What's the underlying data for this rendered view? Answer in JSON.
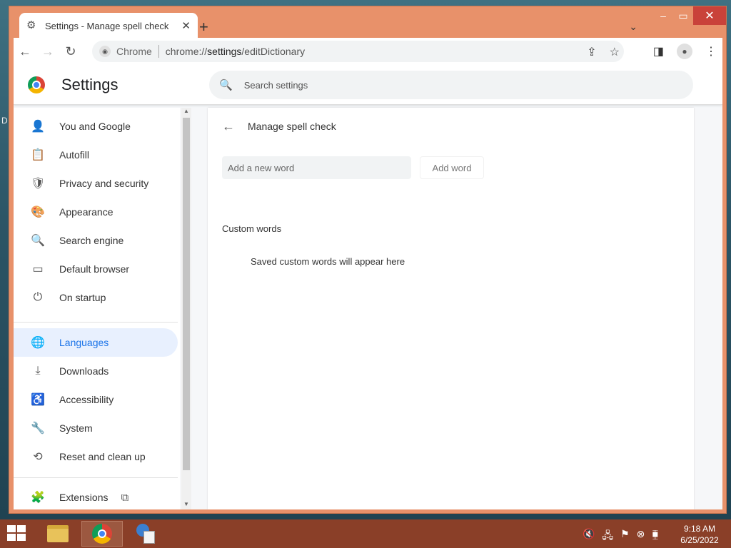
{
  "desktop": {
    "edge_glyph": "D"
  },
  "window": {
    "tab": {
      "title": "Settings - Manage spell check",
      "favicon": "gear-icon",
      "close": "✕"
    },
    "new_tab": "+",
    "tab_search_chevron": "⌄",
    "controls": {
      "minimize": "–",
      "maximize": "▭",
      "close": "✕"
    }
  },
  "toolbar": {
    "back": "←",
    "forward": "→",
    "reload": "↻",
    "site_label": "Chrome",
    "url_scheme": "chrome://",
    "url_host": "settings",
    "url_path": "/editDictionary",
    "share": "⇪",
    "bookmark": "☆",
    "side_panel": "◨",
    "menu": "⋮"
  },
  "settings": {
    "title": "Settings",
    "search": {
      "placeholder": "Search settings",
      "icon": "search-icon"
    },
    "nav": [
      {
        "label": "You and Google",
        "icon": "person-icon",
        "glyph": "👤"
      },
      {
        "label": "Autofill",
        "icon": "clipboard-icon",
        "glyph": "📋"
      },
      {
        "label": "Privacy and security",
        "icon": "shield-icon",
        "glyph": "🛡"
      },
      {
        "label": "Appearance",
        "icon": "palette-icon",
        "glyph": "🎨"
      },
      {
        "label": "Search engine",
        "icon": "search-icon",
        "glyph": "🔍"
      },
      {
        "label": "Default browser",
        "icon": "browser-icon",
        "glyph": "▭"
      },
      {
        "label": "On startup",
        "icon": "power-icon",
        "glyph": "⏻"
      },
      {
        "label": "Languages",
        "icon": "globe-icon",
        "glyph": "🌐",
        "active": true
      },
      {
        "label": "Downloads",
        "icon": "download-icon",
        "glyph": "⤓"
      },
      {
        "label": "Accessibility",
        "icon": "accessibility-icon",
        "glyph": "♿"
      },
      {
        "label": "System",
        "icon": "wrench-icon",
        "glyph": "🔧"
      },
      {
        "label": "Reset and clean up",
        "icon": "history-icon",
        "glyph": "⟲"
      },
      {
        "label": "Extensions",
        "icon": "puzzle-icon",
        "glyph": "🧩",
        "external": "⧉"
      }
    ]
  },
  "spellcheck": {
    "back": "←",
    "title": "Manage spell check",
    "input_placeholder": "Add a new word",
    "input_value": "",
    "add_button": "Add word",
    "custom_words_label": "Custom words",
    "empty_message": "Saved custom words will appear here"
  },
  "taskbar": {
    "apps": [
      {
        "name": "file-explorer",
        "active": false
      },
      {
        "name": "chrome",
        "active": true
      },
      {
        "name": "network-connections",
        "active": false
      }
    ],
    "tray": [
      "🔇",
      "🖧",
      "⚑",
      "⊗",
      "⧯"
    ],
    "time": "9:18 AM",
    "date": "6/25/2022"
  },
  "colors": {
    "window_frame": "#e8916a",
    "accent": "#1a73e8",
    "active_nav_bg": "#e8f0fe",
    "taskbar": "#8a3f28",
    "close_button": "#c9423a"
  }
}
